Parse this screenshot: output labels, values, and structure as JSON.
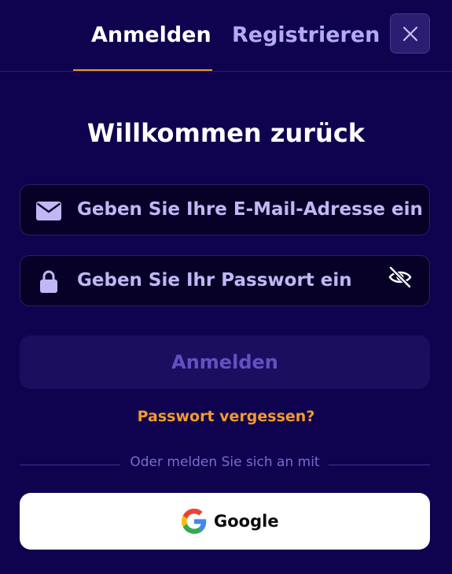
{
  "tabs": {
    "login": "Anmelden",
    "register": "Registrieren",
    "active": "login"
  },
  "title": "Willkommen zurück",
  "email": {
    "placeholder": "Geben Sie Ihre E-Mail-Adresse ein",
    "icon": "envelope-icon"
  },
  "password": {
    "placeholder": "Geben Sie Ihr Passwort ein",
    "icon": "lock-icon",
    "toggle_icon": "eye-slash-icon"
  },
  "submit_label": "Anmelden",
  "forgot_label": "Passwort vergessen?",
  "divider_label": "Oder melden Sie sich an mit",
  "google_label": "Google",
  "close_icon": "close-icon",
  "colors": {
    "background": "#0f0350",
    "accent": "#f0952a",
    "field_bg": "#080127",
    "placeholder": "#c2b6f5",
    "disabled_button": "#1b0e5f"
  }
}
